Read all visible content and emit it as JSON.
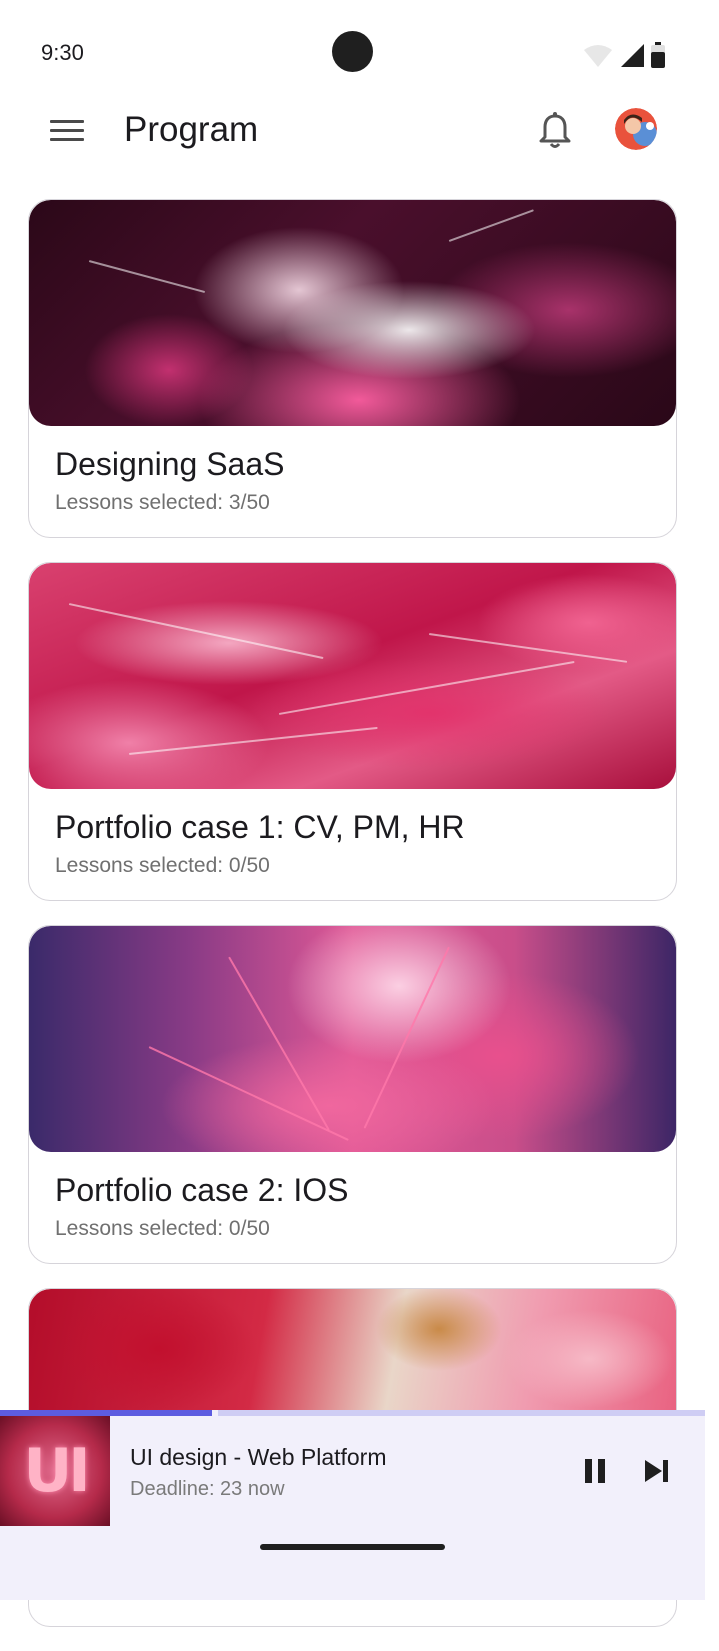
{
  "status_bar": {
    "time": "9:30"
  },
  "app_bar": {
    "title": "Program"
  },
  "programs": [
    {
      "title": "Designing SaaS",
      "subtitle": "Lessons selected: 3/50"
    },
    {
      "title": "Portfolio case 1: CV, PM, HR",
      "subtitle": "Lessons selected: 0/50"
    },
    {
      "title": "Portfolio case 2: IOS",
      "subtitle": "Lessons selected: 0/50"
    },
    {
      "title": "",
      "subtitle": ""
    }
  ],
  "player": {
    "thumbnail_text": "UI",
    "title": "UI design - Web Platform",
    "subtitle": "Deadline: 23 now",
    "progress_fraction": 0.3
  },
  "colors": {
    "accent": "#5d5ce0",
    "player_bg": "#f2f0fb",
    "progress_track": "#cfcdf4"
  }
}
